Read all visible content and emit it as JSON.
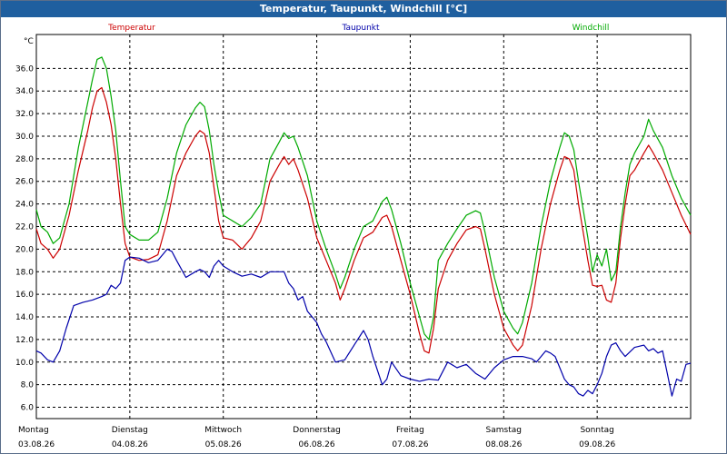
{
  "window": {
    "title": "Temperatur, Taupunkt, Windchill [°C]"
  },
  "chart_data": {
    "type": "line",
    "title": "Temperatur, Taupunkt, Windchill [°C]",
    "ylabel": "°C",
    "ylim": [
      5.0,
      39.0
    ],
    "yticks": [
      6.0,
      8.0,
      10.0,
      12.0,
      14.0,
      16.0,
      18.0,
      20.0,
      22.0,
      24.0,
      26.0,
      28.0,
      30.0,
      32.0,
      34.0,
      36.0
    ],
    "xlim": [
      0,
      7
    ],
    "x_ticks": [
      {
        "day": "Montag",
        "date": "03.08.26"
      },
      {
        "day": "Dienstag",
        "date": "04.08.26"
      },
      {
        "day": "Mittwoch",
        "date": "05.08.26"
      },
      {
        "day": "Donnerstag",
        "date": "06.08.26"
      },
      {
        "day": "Freitag",
        "date": "07.08.26"
      },
      {
        "day": "Samstag",
        "date": "08.08.26"
      },
      {
        "day": "Sonntag",
        "date": "09.08.26"
      }
    ],
    "grid": true,
    "legend_position": "top",
    "series": [
      {
        "name": "Temperatur",
        "color": "#cc0000",
        "points": [
          [
            0,
            21.8
          ],
          [
            0.05,
            20.5
          ],
          [
            0.12,
            20.0
          ],
          [
            0.18,
            19.2
          ],
          [
            0.25,
            20.0
          ],
          [
            0.35,
            23.0
          ],
          [
            0.45,
            27.0
          ],
          [
            0.55,
            30.5
          ],
          [
            0.6,
            32.5
          ],
          [
            0.65,
            34.0
          ],
          [
            0.7,
            34.3
          ],
          [
            0.75,
            33.0
          ],
          [
            0.8,
            31.0
          ],
          [
            0.85,
            28.0
          ],
          [
            0.9,
            24.0
          ],
          [
            0.95,
            20.5
          ],
          [
            1.0,
            19.3
          ],
          [
            1.1,
            19.0
          ],
          [
            1.2,
            19.1
          ],
          [
            1.3,
            19.5
          ],
          [
            1.4,
            22.5
          ],
          [
            1.5,
            26.5
          ],
          [
            1.6,
            28.5
          ],
          [
            1.7,
            30.0
          ],
          [
            1.75,
            30.5
          ],
          [
            1.8,
            30.2
          ],
          [
            1.85,
            28.5
          ],
          [
            1.9,
            25.5
          ],
          [
            1.95,
            22.5
          ],
          [
            2.0,
            21.0
          ],
          [
            2.1,
            20.8
          ],
          [
            2.2,
            20.0
          ],
          [
            2.3,
            21.0
          ],
          [
            2.4,
            22.5
          ],
          [
            2.5,
            26.0
          ],
          [
            2.6,
            27.5
          ],
          [
            2.65,
            28.2
          ],
          [
            2.7,
            27.5
          ],
          [
            2.75,
            28.0
          ],
          [
            2.8,
            27.0
          ],
          [
            2.9,
            24.5
          ],
          [
            3.0,
            21.0
          ],
          [
            3.1,
            19.0
          ],
          [
            3.2,
            17.0
          ],
          [
            3.25,
            15.5
          ],
          [
            3.3,
            16.5
          ],
          [
            3.4,
            19.0
          ],
          [
            3.5,
            21.0
          ],
          [
            3.6,
            21.5
          ],
          [
            3.7,
            22.8
          ],
          [
            3.75,
            23.0
          ],
          [
            3.8,
            22.0
          ],
          [
            3.9,
            19.0
          ],
          [
            4.0,
            16.0
          ],
          [
            4.1,
            12.5
          ],
          [
            4.15,
            11.0
          ],
          [
            4.2,
            10.8
          ],
          [
            4.25,
            13.0
          ],
          [
            4.3,
            16.5
          ],
          [
            4.4,
            19.0
          ],
          [
            4.5,
            20.5
          ],
          [
            4.6,
            21.7
          ],
          [
            4.7,
            22.0
          ],
          [
            4.75,
            21.8
          ],
          [
            4.8,
            20.0
          ],
          [
            4.9,
            16.0
          ],
          [
            5.0,
            13.0
          ],
          [
            5.1,
            11.5
          ],
          [
            5.15,
            11.0
          ],
          [
            5.2,
            11.5
          ],
          [
            5.3,
            15.0
          ],
          [
            5.4,
            20.0
          ],
          [
            5.5,
            24.0
          ],
          [
            5.6,
            27.0
          ],
          [
            5.65,
            28.2
          ],
          [
            5.7,
            28.0
          ],
          [
            5.75,
            27.0
          ],
          [
            5.8,
            24.0
          ],
          [
            5.9,
            19.0
          ],
          [
            5.95,
            16.8
          ],
          [
            6.0,
            16.7
          ],
          [
            6.05,
            16.8
          ],
          [
            6.1,
            15.5
          ],
          [
            6.15,
            15.3
          ],
          [
            6.2,
            17.0
          ],
          [
            6.25,
            21.0
          ],
          [
            6.3,
            24.0
          ],
          [
            6.35,
            26.5
          ],
          [
            6.4,
            27.0
          ],
          [
            6.5,
            28.5
          ],
          [
            6.55,
            29.2
          ],
          [
            6.6,
            28.5
          ],
          [
            6.7,
            27.0
          ],
          [
            6.8,
            25.0
          ],
          [
            6.9,
            23.0
          ],
          [
            7.0,
            21.3
          ]
        ]
      },
      {
        "name": "Taupunkt",
        "color": "#0000aa",
        "points": [
          [
            0,
            11.0
          ],
          [
            0.05,
            10.8
          ],
          [
            0.12,
            10.2
          ],
          [
            0.18,
            10.0
          ],
          [
            0.25,
            11.0
          ],
          [
            0.32,
            13.0
          ],
          [
            0.4,
            15.0
          ],
          [
            0.5,
            15.3
          ],
          [
            0.6,
            15.5
          ],
          [
            0.7,
            15.8
          ],
          [
            0.75,
            16.0
          ],
          [
            0.8,
            16.8
          ],
          [
            0.85,
            16.5
          ],
          [
            0.9,
            17.0
          ],
          [
            0.95,
            19.0
          ],
          [
            1.0,
            19.3
          ],
          [
            1.1,
            19.2
          ],
          [
            1.2,
            18.8
          ],
          [
            1.3,
            19.0
          ],
          [
            1.35,
            19.5
          ],
          [
            1.4,
            20.0
          ],
          [
            1.45,
            19.8
          ],
          [
            1.5,
            19.0
          ],
          [
            1.6,
            17.5
          ],
          [
            1.7,
            18.0
          ],
          [
            1.75,
            18.2
          ],
          [
            1.8,
            18.0
          ],
          [
            1.85,
            17.5
          ],
          [
            1.9,
            18.5
          ],
          [
            1.95,
            19.0
          ],
          [
            2.0,
            18.5
          ],
          [
            2.1,
            18.0
          ],
          [
            2.2,
            17.6
          ],
          [
            2.3,
            17.8
          ],
          [
            2.4,
            17.5
          ],
          [
            2.5,
            18.0
          ],
          [
            2.6,
            18.0
          ],
          [
            2.65,
            18.0
          ],
          [
            2.7,
            17.0
          ],
          [
            2.75,
            16.5
          ],
          [
            2.8,
            15.5
          ],
          [
            2.85,
            15.8
          ],
          [
            2.9,
            14.5
          ],
          [
            3.0,
            13.5
          ],
          [
            3.05,
            12.5
          ],
          [
            3.1,
            11.8
          ],
          [
            3.2,
            10.0
          ],
          [
            3.3,
            10.2
          ],
          [
            3.4,
            11.5
          ],
          [
            3.5,
            12.8
          ],
          [
            3.55,
            12.0
          ],
          [
            3.6,
            10.5
          ],
          [
            3.7,
            8.0
          ],
          [
            3.75,
            8.5
          ],
          [
            3.8,
            10.0
          ],
          [
            3.9,
            8.8
          ],
          [
            4.0,
            8.5
          ],
          [
            4.1,
            8.3
          ],
          [
            4.2,
            8.5
          ],
          [
            4.3,
            8.4
          ],
          [
            4.4,
            10.0
          ],
          [
            4.5,
            9.5
          ],
          [
            4.6,
            9.8
          ],
          [
            4.7,
            9.0
          ],
          [
            4.8,
            8.5
          ],
          [
            4.9,
            9.5
          ],
          [
            5.0,
            10.2
          ],
          [
            5.1,
            10.5
          ],
          [
            5.2,
            10.5
          ],
          [
            5.3,
            10.3
          ],
          [
            5.35,
            10.0
          ],
          [
            5.4,
            10.5
          ],
          [
            5.45,
            11.0
          ],
          [
            5.5,
            10.8
          ],
          [
            5.55,
            10.5
          ],
          [
            5.6,
            9.5
          ],
          [
            5.65,
            8.5
          ],
          [
            5.7,
            8.0
          ],
          [
            5.75,
            7.8
          ],
          [
            5.8,
            7.2
          ],
          [
            5.85,
            7.0
          ],
          [
            5.9,
            7.5
          ],
          [
            5.95,
            7.2
          ],
          [
            6.0,
            8.0
          ],
          [
            6.05,
            9.0
          ],
          [
            6.1,
            10.5
          ],
          [
            6.15,
            11.5
          ],
          [
            6.2,
            11.7
          ],
          [
            6.25,
            11.0
          ],
          [
            6.3,
            10.5
          ],
          [
            6.4,
            11.3
          ],
          [
            6.5,
            11.5
          ],
          [
            6.55,
            11.0
          ],
          [
            6.6,
            11.2
          ],
          [
            6.65,
            10.8
          ],
          [
            6.7,
            11.0
          ],
          [
            6.75,
            9.0
          ],
          [
            6.8,
            7.0
          ],
          [
            6.85,
            8.5
          ],
          [
            6.9,
            8.3
          ],
          [
            6.95,
            9.8
          ],
          [
            7.0,
            9.9
          ]
        ]
      },
      {
        "name": "Windchill",
        "color": "#00aa00",
        "points": [
          [
            0,
            23.5
          ],
          [
            0.05,
            22.0
          ],
          [
            0.12,
            21.5
          ],
          [
            0.18,
            20.5
          ],
          [
            0.25,
            21.0
          ],
          [
            0.35,
            24.0
          ],
          [
            0.45,
            29.0
          ],
          [
            0.55,
            33.0
          ],
          [
            0.6,
            35.0
          ],
          [
            0.65,
            36.8
          ],
          [
            0.7,
            37.0
          ],
          [
            0.75,
            36.0
          ],
          [
            0.8,
            33.5
          ],
          [
            0.85,
            30.5
          ],
          [
            0.9,
            26.0
          ],
          [
            0.95,
            22.0
          ],
          [
            1.0,
            21.3
          ],
          [
            1.1,
            20.8
          ],
          [
            1.2,
            20.8
          ],
          [
            1.3,
            21.5
          ],
          [
            1.4,
            24.5
          ],
          [
            1.5,
            28.5
          ],
          [
            1.6,
            31.0
          ],
          [
            1.7,
            32.5
          ],
          [
            1.75,
            33.0
          ],
          [
            1.8,
            32.6
          ],
          [
            1.85,
            30.5
          ],
          [
            1.9,
            27.5
          ],
          [
            1.95,
            25.0
          ],
          [
            2.0,
            23.0
          ],
          [
            2.1,
            22.5
          ],
          [
            2.2,
            22.0
          ],
          [
            2.3,
            22.8
          ],
          [
            2.4,
            24.0
          ],
          [
            2.5,
            28.0
          ],
          [
            2.6,
            29.5
          ],
          [
            2.65,
            30.3
          ],
          [
            2.7,
            29.8
          ],
          [
            2.75,
            30.0
          ],
          [
            2.8,
            29.0
          ],
          [
            2.9,
            26.5
          ],
          [
            3.0,
            22.5
          ],
          [
            3.1,
            20.0
          ],
          [
            3.2,
            17.8
          ],
          [
            3.25,
            16.5
          ],
          [
            3.3,
            17.5
          ],
          [
            3.4,
            20.0
          ],
          [
            3.5,
            22.0
          ],
          [
            3.6,
            22.5
          ],
          [
            3.7,
            24.2
          ],
          [
            3.75,
            24.6
          ],
          [
            3.8,
            23.5
          ],
          [
            3.9,
            20.5
          ],
          [
            4.0,
            17.0
          ],
          [
            4.1,
            14.0
          ],
          [
            4.15,
            12.5
          ],
          [
            4.2,
            12.0
          ],
          [
            4.25,
            14.0
          ],
          [
            4.3,
            19.0
          ],
          [
            4.4,
            20.5
          ],
          [
            4.5,
            21.8
          ],
          [
            4.6,
            23.0
          ],
          [
            4.7,
            23.4
          ],
          [
            4.75,
            23.2
          ],
          [
            4.8,
            21.5
          ],
          [
            4.9,
            17.5
          ],
          [
            5.0,
            14.5
          ],
          [
            5.1,
            13.0
          ],
          [
            5.15,
            12.5
          ],
          [
            5.2,
            13.5
          ],
          [
            5.3,
            17.0
          ],
          [
            5.4,
            22.0
          ],
          [
            5.5,
            26.0
          ],
          [
            5.6,
            29.0
          ],
          [
            5.65,
            30.3
          ],
          [
            5.7,
            30.0
          ],
          [
            5.75,
            28.8
          ],
          [
            5.8,
            26.0
          ],
          [
            5.9,
            21.0
          ],
          [
            5.95,
            18.0
          ],
          [
            6.0,
            19.5
          ],
          [
            6.05,
            18.5
          ],
          [
            6.1,
            20.0
          ],
          [
            6.15,
            17.2
          ],
          [
            6.2,
            18.0
          ],
          [
            6.25,
            22.0
          ],
          [
            6.3,
            25.0
          ],
          [
            6.35,
            27.5
          ],
          [
            6.4,
            28.5
          ],
          [
            6.5,
            30.0
          ],
          [
            6.55,
            31.5
          ],
          [
            6.6,
            30.5
          ],
          [
            6.7,
            29.0
          ],
          [
            6.8,
            26.5
          ],
          [
            6.9,
            24.5
          ],
          [
            7.0,
            23.0
          ]
        ]
      }
    ]
  }
}
